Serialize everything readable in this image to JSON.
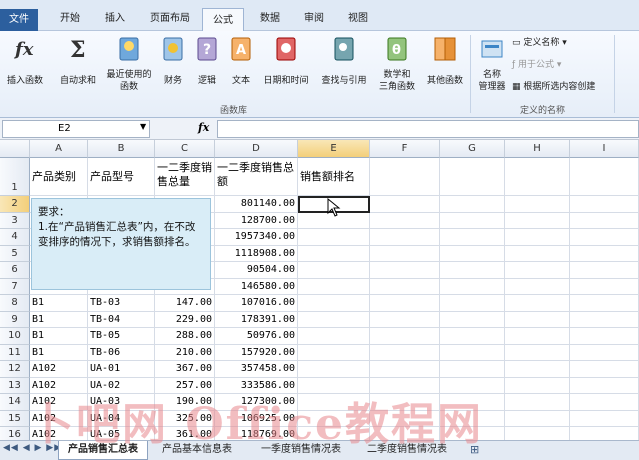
{
  "tabs": [
    "文件",
    "开始",
    "插入",
    "页面布局",
    "公式",
    "数据",
    "审阅",
    "视图"
  ],
  "ribbon": {
    "buttons": [
      "插入函数",
      "自动求和",
      "最近使用的\n函数",
      "财务",
      "逻辑",
      "文本",
      "日期和时间",
      "查找与引用",
      "数学和\n三角函数",
      "其他函数",
      "名称\n管理器"
    ],
    "name_cmds": [
      "定义名称",
      "用于公式",
      "根据所选内容创建"
    ],
    "group_funclib": "函数库",
    "group_names": "定义的名称"
  },
  "formula_bar": {
    "name": "E2",
    "fx": "fx"
  },
  "columns": [
    "A",
    "B",
    "C",
    "D",
    "E",
    "F",
    "G",
    "H",
    "I"
  ],
  "row_numbers": [
    "1",
    "2",
    "3",
    "4",
    "5",
    "6",
    "7",
    "8",
    "9",
    "10",
    "11",
    "12",
    "13",
    "14",
    "15",
    "16"
  ],
  "header_row": [
    "产品类别",
    "产品型号",
    "一二季度销售总量",
    "一二季度销售总额",
    "销售额排名"
  ],
  "rows": [
    [
      "",
      "",
      "",
      "801140.00"
    ],
    [
      "",
      "",
      "",
      "128700.00"
    ],
    [
      "",
      "",
      "",
      "1957340.00"
    ],
    [
      "",
      "",
      "",
      "1118908.00"
    ],
    [
      "",
      "",
      "",
      "90504.00"
    ],
    [
      "",
      "",
      "",
      "146580.00"
    ],
    [
      "B1",
      "TB-03",
      "147.00",
      "107016.00"
    ],
    [
      "B1",
      "TB-04",
      "229.00",
      "178391.00"
    ],
    [
      "B1",
      "TB-05",
      "288.00",
      "50976.00"
    ],
    [
      "B1",
      "TB-06",
      "210.00",
      "157920.00"
    ],
    [
      "A102",
      "UA-01",
      "367.00",
      "357458.00"
    ],
    [
      "A102",
      "UA-02",
      "257.00",
      "333586.00"
    ],
    [
      "A102",
      "UA-03",
      "190.00",
      "127300.00"
    ],
    [
      "A102",
      "UA-04",
      "325.00",
      "106925.00"
    ],
    [
      "A102",
      "UA-05",
      "361.00",
      "118769.00"
    ]
  ],
  "note": "要求：\n1.在“产品销售汇总表”内，在不改变排序的情况下，求销售额排名。",
  "sheet_tabs": [
    "产品销售汇总表",
    "产品基本信息表",
    "一季度销售情况表",
    "二季度销售情况表"
  ],
  "watermark": "卜吧网 Office教程网",
  "colors": {
    "file_tab": "#2c5f9e",
    "accent": "#f3cf7a",
    "note_bg": "#d9edf7"
  }
}
